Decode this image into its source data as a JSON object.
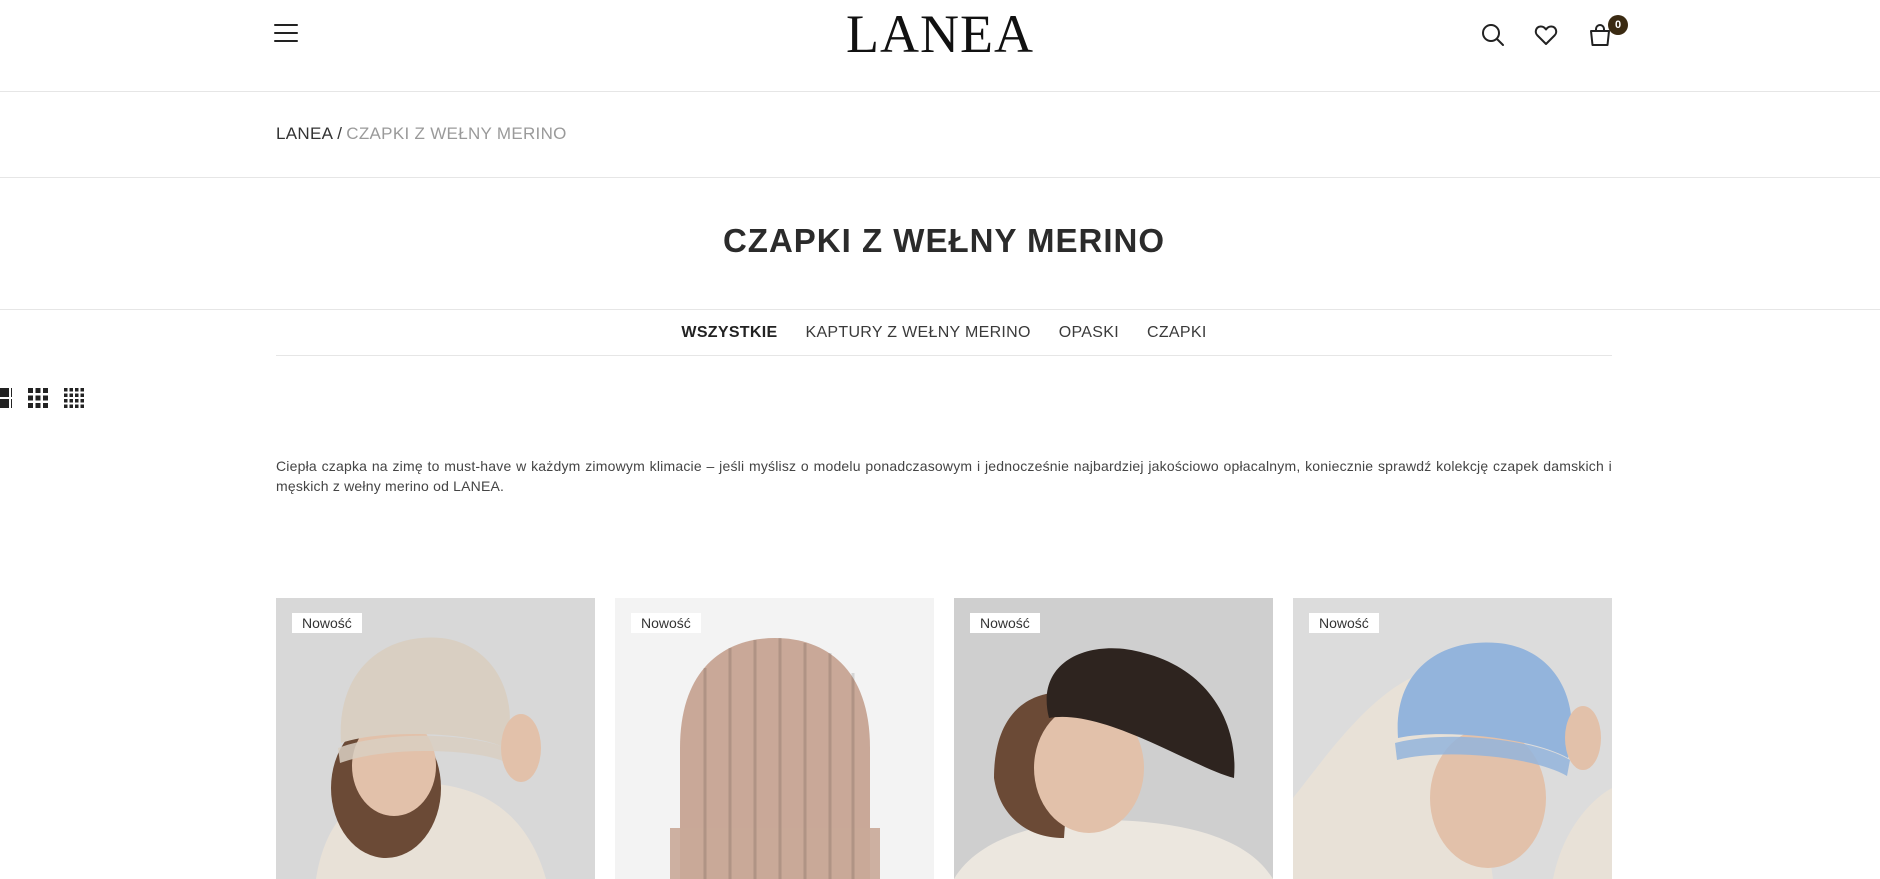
{
  "header": {
    "logo_text": "LANEA",
    "cart_count": "0",
    "icons": [
      "menu-icon",
      "search-icon",
      "heart-icon",
      "cart-icon"
    ]
  },
  "breadcrumb": {
    "home": "LANEA",
    "separator": "/",
    "current": "CZAPKI Z WEŁNY MERINO"
  },
  "page": {
    "title": "CZAPKI Z WEŁNY MERINO",
    "description": "Ciepła czapka na zimę to must-have w każdym zimowym klimacie – jeśli myślisz o modelu ponadczasowym i jednocześnie najbardziej jakościowo opłacalnym, koniecznie sprawdź kolekcję czapek damskich i męskich z wełny merino od LANEA."
  },
  "tabs": [
    {
      "label": "WSZYSTKIE",
      "active": true
    },
    {
      "label": "KAPTURY Z WEŁNY MERINO",
      "active": false
    },
    {
      "label": "OPASKI",
      "active": false
    },
    {
      "label": "CZAPKI",
      "active": false
    }
  ],
  "view_options": [
    "grid-2-icon",
    "grid-3-icon",
    "grid-4-icon"
  ],
  "products": [
    {
      "badge": "Nowość",
      "hat_color": "#d9cfc2",
      "bg_color": "#d8d8d8"
    },
    {
      "badge": "Nowość",
      "hat_color": "#c9a898",
      "bg_color": "#f3f3f3"
    },
    {
      "badge": "Nowość",
      "hat_color": "#2e241f",
      "bg_color": "#cfcfcf"
    },
    {
      "badge": "Nowość",
      "hat_color": "#93b4dc",
      "bg_color": "#dcdcdc"
    }
  ],
  "colors": {
    "accent": "#3a2a12",
    "text": "#2b2b2b",
    "muted": "#9a9a9a",
    "divider": "#e6e6e6"
  }
}
